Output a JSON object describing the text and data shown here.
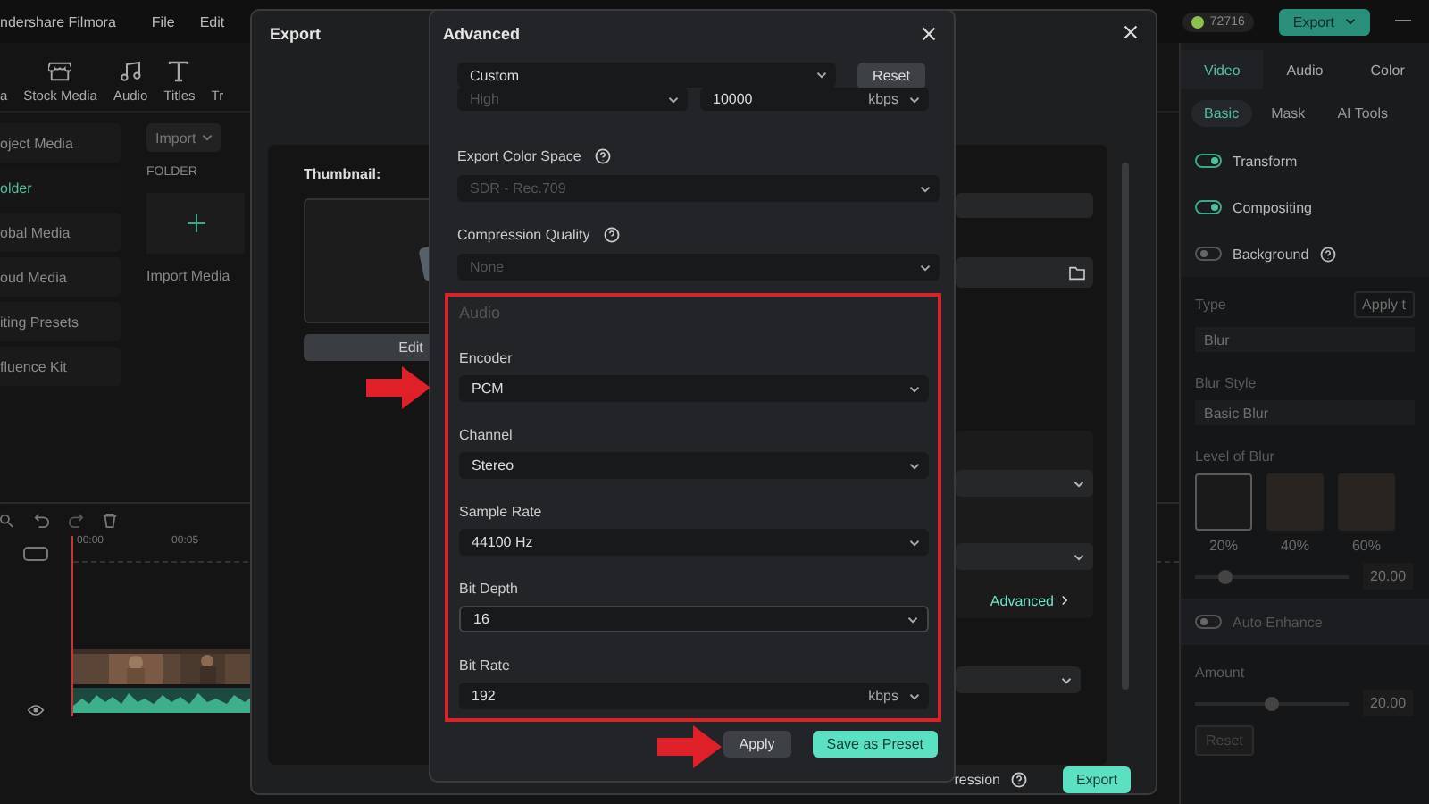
{
  "app": {
    "title": "ndershare Filmora",
    "menu": [
      "File",
      "Edit"
    ],
    "toolbar": [
      {
        "label": "a",
        "kind": "plain"
      },
      {
        "label": "Stock Media",
        "kind": "store"
      },
      {
        "label": "Audio",
        "kind": "note"
      },
      {
        "label": "Titles",
        "kind": "text"
      },
      {
        "label": "Tr",
        "kind": "plain"
      }
    ],
    "coins": "72716",
    "export_button": "Export"
  },
  "sidebar": {
    "items": [
      {
        "label": "oject Media",
        "selected": false
      },
      {
        "label": "older",
        "selected": true
      },
      {
        "label": "obal Media",
        "selected": false
      },
      {
        "label": "oud Media",
        "selected": false
      },
      {
        "label": "iting Presets",
        "selected": false
      },
      {
        "label": "fluence Kit",
        "selected": false
      }
    ]
  },
  "media": {
    "import_button": "Import",
    "folder_heading": "FOLDER",
    "import_tile": "Import Media"
  },
  "timeline": {
    "ruler": [
      "00:00",
      "00:05"
    ]
  },
  "inspector": {
    "tabs": [
      {
        "label": "Video",
        "selected": true
      },
      {
        "label": "Audio",
        "selected": false
      },
      {
        "label": "Color",
        "selected": false
      }
    ],
    "subtabs": [
      {
        "label": "Basic",
        "selected": true
      },
      {
        "label": "Mask",
        "selected": false
      },
      {
        "label": "AI Tools",
        "selected": false
      }
    ],
    "toggles": [
      {
        "label": "Transform",
        "on": true,
        "help": false
      },
      {
        "label": "Compositing",
        "on": true,
        "help": false
      },
      {
        "label": "Background",
        "on": false,
        "help": true
      }
    ],
    "type_label": "Type",
    "apply_button": "Apply t",
    "type_value": "Blur",
    "style_label": "Blur Style",
    "style_value": "Basic Blur",
    "level_label": "Level of Blur",
    "presets": [
      {
        "label": "20%",
        "selected": true
      },
      {
        "label": "40%",
        "selected": false
      },
      {
        "label": "60%",
        "selected": false
      }
    ],
    "blur_slider": {
      "level": 0.2,
      "reading": "20.00"
    },
    "auto_enhance": {
      "label": "Auto Enhance",
      "on": false
    },
    "amount_label": "Amount",
    "amount_slider": {
      "level": 0.5,
      "reading": "20.00"
    },
    "reset_button": "Reset"
  },
  "export": {
    "title": "Export",
    "thumbnail_label": "Thumbnail:",
    "edit_button": "Edit",
    "advanced_link": "Advanced",
    "footer_text": "ression",
    "export_button": "Export"
  },
  "advanced": {
    "title": "Advanced",
    "preset": "Custom",
    "reset_button": "Reset",
    "quality": "High",
    "bitrate": "10000",
    "bitrate_unit": "kbps",
    "color_space": {
      "label": "Export Color Space",
      "value": "SDR - Rec.709",
      "disabled": true
    },
    "compression": {
      "label": "Compression Quality",
      "value": "None",
      "disabled": true
    },
    "audio": {
      "heading": "Audio",
      "fields": [
        {
          "label": "Encoder",
          "value": "PCM",
          "focused": false
        },
        {
          "label": "Channel",
          "value": "Stereo",
          "focused": false
        },
        {
          "label": "Sample Rate",
          "value": "44100 Hz",
          "focused": false
        },
        {
          "label": "Bit Depth",
          "value": "16",
          "focused": true
        },
        {
          "label": "Bit Rate",
          "value": "192",
          "unit": "kbps",
          "focused": false
        }
      ]
    },
    "apply_button": "Apply",
    "save_button": "Save as Preset"
  }
}
